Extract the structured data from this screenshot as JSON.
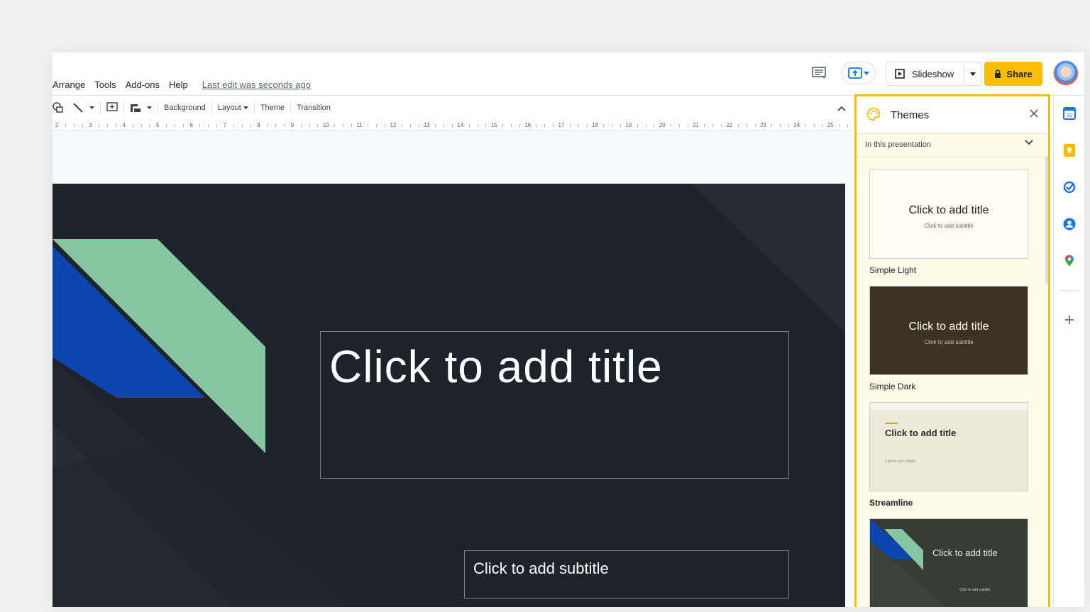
{
  "menu": {
    "items": [
      "Arrange",
      "Tools",
      "Add-ons",
      "Help"
    ],
    "last_edit": "Last edit was seconds ago"
  },
  "header": {
    "slideshow_label": "Slideshow",
    "share_label": "Share"
  },
  "toolbar": {
    "background_label": "Background",
    "layout_label": "Layout",
    "theme_label": "Theme",
    "transition_label": "Transition"
  },
  "ruler": {
    "numbers": [
      "2",
      "3",
      "4",
      "5",
      "6",
      "7",
      "8",
      "9",
      "10",
      "11",
      "12",
      "13",
      "14",
      "15",
      "16",
      "17",
      "18",
      "19",
      "20",
      "21",
      "22",
      "23",
      "24",
      "25"
    ]
  },
  "slide": {
    "title": "Click to add title",
    "subtitle": "Click to add subtitle",
    "colors": {
      "background": "#1e222a",
      "green": "#84c6a0",
      "blue": "#0b46b0"
    }
  },
  "themes_panel": {
    "title": "Themes",
    "filter": "In this presentation",
    "themes": [
      {
        "name": "Simple Light",
        "thumb_title": "Click to add title",
        "thumb_subtitle": "Click to add subtitle"
      },
      {
        "name": "Simple Dark",
        "thumb_title": "Click to add title",
        "thumb_subtitle": "Click to add subtitle"
      },
      {
        "name": "Streamline",
        "thumb_title": "Click to add title",
        "thumb_subtitle": "Click to add subtitle"
      },
      {
        "name": "",
        "thumb_title": "Click to add title",
        "thumb_subtitle": "Click to add subtitle"
      }
    ]
  },
  "side_rail": {
    "icons": [
      "calendar-icon",
      "keep-icon",
      "tasks-icon",
      "contacts-icon",
      "maps-icon",
      "add-icon"
    ]
  },
  "accent": "#fbbc04"
}
